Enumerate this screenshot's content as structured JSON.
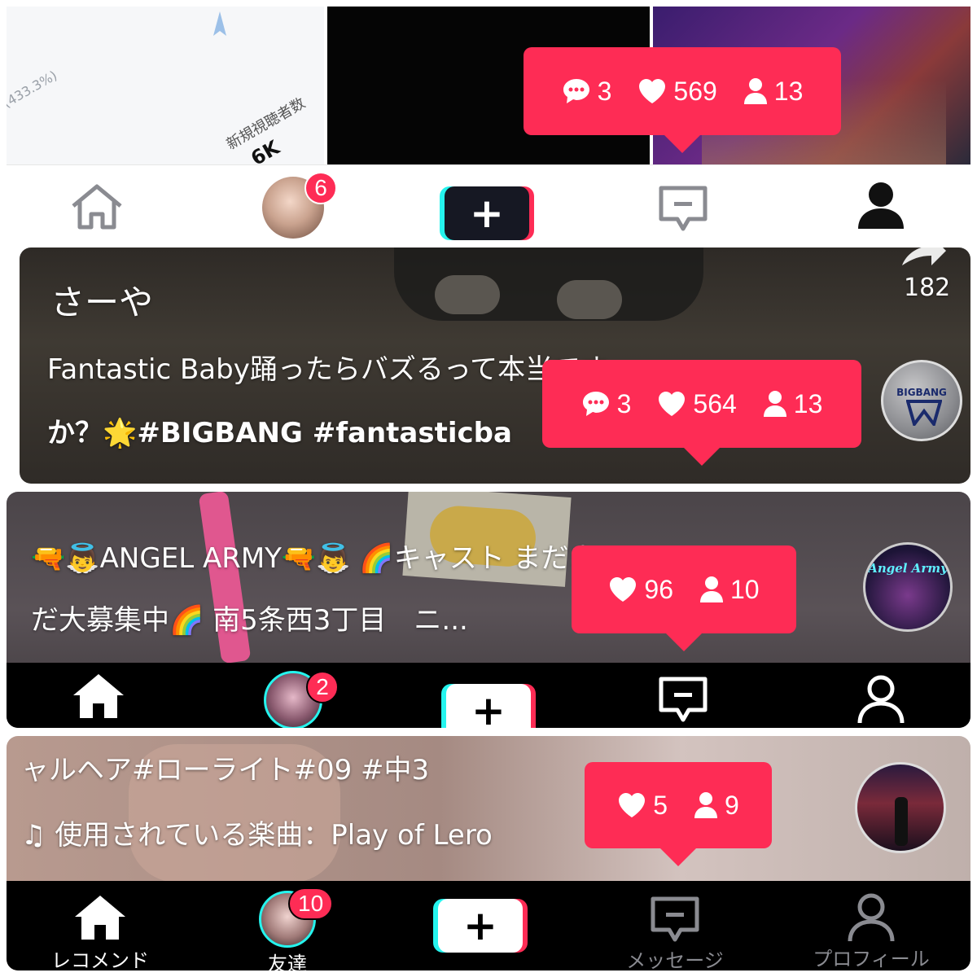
{
  "panel1": {
    "analytics_percent": "(433.3%)",
    "analytics_label": "新規視聴者数",
    "analytics_value": "6K",
    "bubble": {
      "comments": "3",
      "likes": "569",
      "followers": "13"
    },
    "nav": {
      "friends_badge": "6"
    }
  },
  "panel2": {
    "username": "さーや",
    "caption_line1": "Fantastic Baby踊ったらバズるって本当です",
    "caption_line2": "か？🌟#BIGBANG #fantasticba",
    "share_count": "182",
    "avatar_text": "BIGBANG",
    "bubble": {
      "comments": "3",
      "likes": "564",
      "followers": "13"
    }
  },
  "panel3": {
    "caption_line1": "🔫👼ANGEL ARMY🔫👼 🌈キャスト まだま",
    "caption_line2": "だ大募集中🌈 南5条西3丁目　ニ...",
    "avatar_text": "Angel Army",
    "bubble": {
      "likes": "96",
      "followers": "10"
    },
    "nav": {
      "friends_badge": "2"
    }
  },
  "panel4": {
    "caption_line1": "ャルヘア#ローライト#09 #中3",
    "caption_line2": "♫ 使用されている楽曲：Play of Lero",
    "bubble": {
      "likes": "5",
      "followers": "9"
    },
    "nav": {
      "friends_badge": "10",
      "home_label": "レコメンド",
      "friends_label": "友達",
      "inbox_label": "メッセージ",
      "profile_label": "プロフィール"
    }
  },
  "colors": {
    "accent": "#fe2c55",
    "cyan": "#25f4ee",
    "dark": "#161823"
  }
}
